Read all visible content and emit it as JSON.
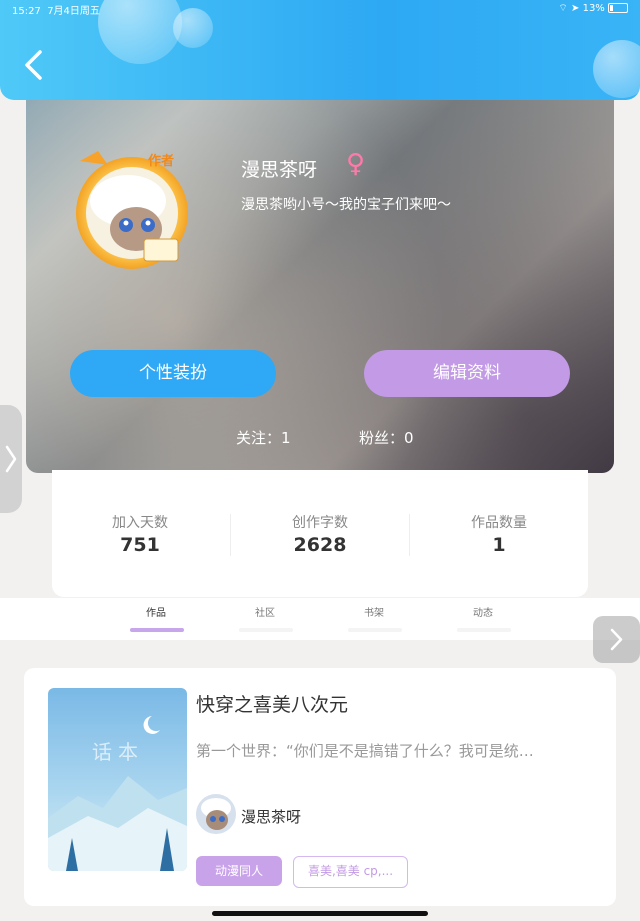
{
  "status_bar": {
    "time": "15:27",
    "date": "7月4日周五",
    "battery": "13%"
  },
  "profile": {
    "name": "漫思茶呀",
    "gender_symbol": "♀",
    "signature": "漫思茶哟小号～我的宝子们来吧～",
    "badge": "作者",
    "buttons": {
      "dress_up": "个性装扮",
      "edit_profile": "编辑资料"
    },
    "following": "关注：1",
    "followers": "粉丝：0"
  },
  "stats": [
    {
      "label": "加入天数",
      "value": "751"
    },
    {
      "label": "创作字数",
      "value": "2628"
    },
    {
      "label": "作品数量",
      "value": "1"
    }
  ],
  "tabs": [
    {
      "label": "作品",
      "active": true
    },
    {
      "label": "社区",
      "active": false
    },
    {
      "label": "书架",
      "active": false
    },
    {
      "label": "动态",
      "active": false
    }
  ],
  "work": {
    "cover_text": "话本",
    "title": "快穿之喜美八次元",
    "description": "第一个世界：“你们是不是搞错了什么？我可是统…",
    "author": "漫思茶呀",
    "tags": [
      "动漫同人",
      "喜美,喜美 cp,..."
    ]
  },
  "colors": {
    "primary_blue": "#2fa8f5",
    "purple": "#c39ae6",
    "female_pink": "#ff7aa8"
  }
}
